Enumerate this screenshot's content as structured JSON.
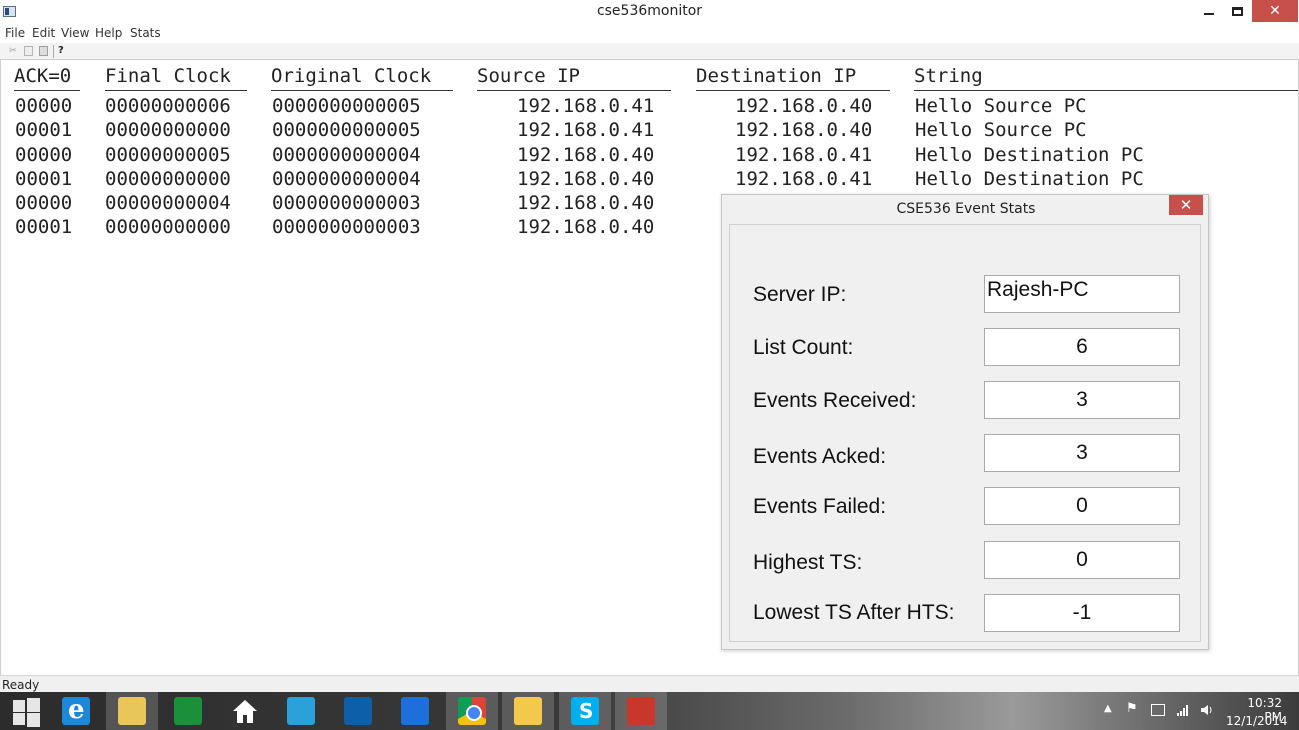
{
  "window": {
    "title": "cse536monitor"
  },
  "menu": {
    "items": [
      "File",
      "Edit",
      "View",
      "Help",
      "Stats"
    ]
  },
  "table": {
    "headers": [
      "ACK=0",
      "Final Clock",
      "Original Clock",
      "Source IP",
      "Destination IP",
      "String"
    ],
    "rows": [
      [
        "00000",
        "00000000006",
        "0000000000005",
        "192.168.0.41",
        "192.168.0.40",
        "Hello Source PC"
      ],
      [
        "00001",
        "00000000000",
        "0000000000005",
        "192.168.0.41",
        "192.168.0.40",
        "Hello Source PC"
      ],
      [
        "00000",
        "00000000005",
        "0000000000004",
        "192.168.0.40",
        "192.168.0.41",
        "Hello Destination PC"
      ],
      [
        "00001",
        "00000000000",
        "0000000000004",
        "192.168.0.40",
        "192.168.0.41",
        "Hello Destination PC"
      ],
      [
        "00000",
        "00000000004",
        "0000000000003",
        "192.168.0.40",
        "",
        ""
      ],
      [
        "00001",
        "00000000000",
        "0000000000003",
        "192.168.0.40",
        "",
        ""
      ]
    ]
  },
  "status": {
    "text": "Ready"
  },
  "dialog": {
    "title": "CSE536 Event Stats",
    "close_glyph": "✕",
    "fields": [
      {
        "label": "Server IP:",
        "value": "Rajesh-PC"
      },
      {
        "label": "List Count:",
        "value": "6"
      },
      {
        "label": "Events Received:",
        "value": "3"
      },
      {
        "label": "Events Acked:",
        "value": "3"
      },
      {
        "label": "Events Failed:",
        "value": "0"
      },
      {
        "label": "Highest TS:",
        "value": "0"
      },
      {
        "label": "Lowest TS After HTS:",
        "value": "-1"
      }
    ]
  },
  "taskbar": {
    "apps": [
      "start-icon",
      "internet-explorer-icon",
      "file-explorer-icon",
      "store-icon",
      "home-icon",
      "mail-icon",
      "monitor-app-icon",
      "maxthon-icon",
      "chrome-icon",
      "puzzle-app-icon",
      "skype-icon",
      "mfc-app-icon"
    ],
    "clock": {
      "time": "10:32 PM",
      "date": "12/1/2014"
    }
  }
}
